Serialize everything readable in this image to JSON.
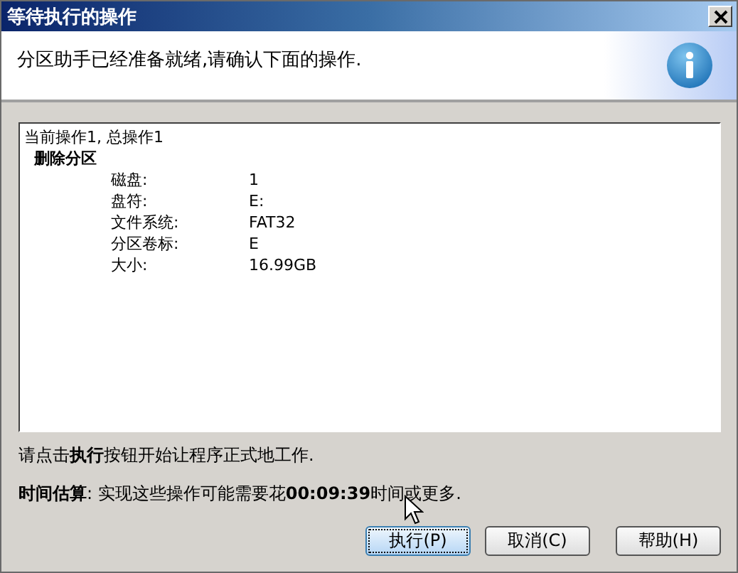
{
  "window": {
    "title": "等待执行的操作"
  },
  "header": {
    "message": "分区助手已经准备就绪,请确认下面的操作."
  },
  "operations": {
    "summary": "当前操作1, 总操作1",
    "title": "删除分区",
    "fields": [
      {
        "label": "磁盘:",
        "value": "1"
      },
      {
        "label": "盘符:",
        "value": "E:"
      },
      {
        "label": "文件系统:",
        "value": "FAT32"
      },
      {
        "label": "分区卷标:",
        "value": "E"
      },
      {
        "label": "大小:",
        "value": "16.99GB"
      }
    ]
  },
  "instruction": "请点击**执行**按钮开始让程序正式地工作.",
  "estimate": "**时间估算**: 实现这些操作可能需要花**00:09:39**时间或更多.",
  "buttons": [
    {
      "label": "执行(P)",
      "focused": true
    },
    {
      "label": "取消(C)",
      "focused": false
    },
    {
      "label": "帮助(H)",
      "focused": false
    }
  ]
}
